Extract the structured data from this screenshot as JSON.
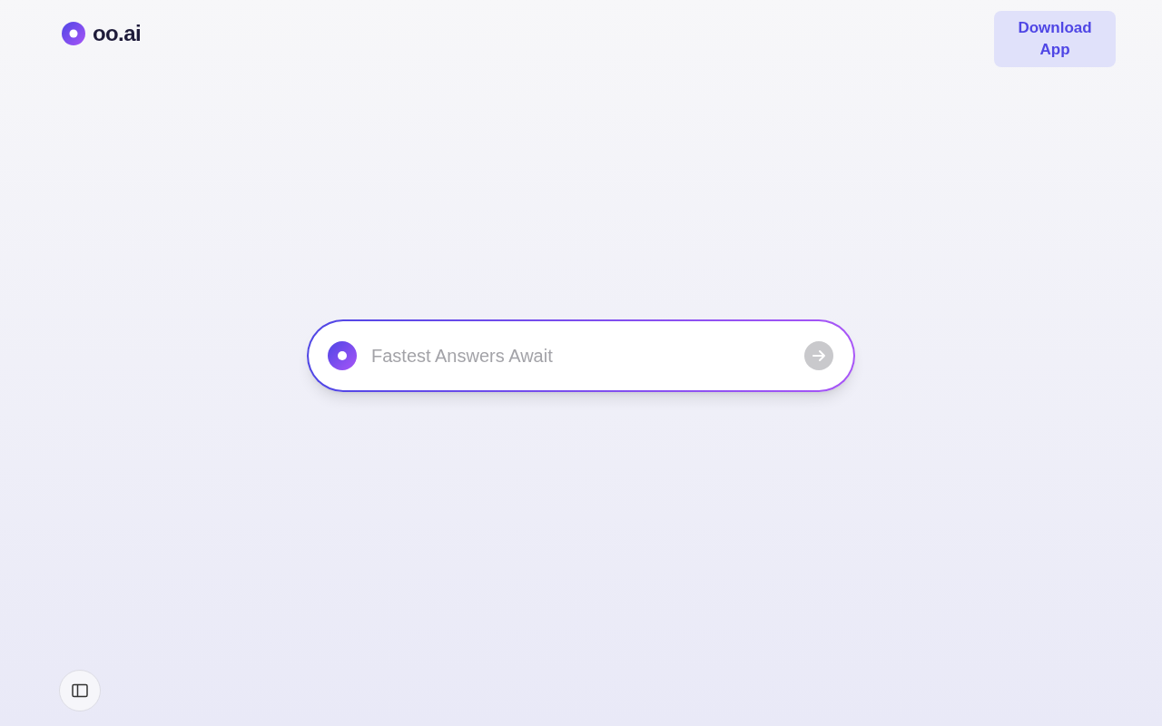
{
  "header": {
    "logo": "oo.ai",
    "download_button": "Download App"
  },
  "search": {
    "placeholder": "Fastest Answers Await",
    "submit_disabled": true
  }
}
